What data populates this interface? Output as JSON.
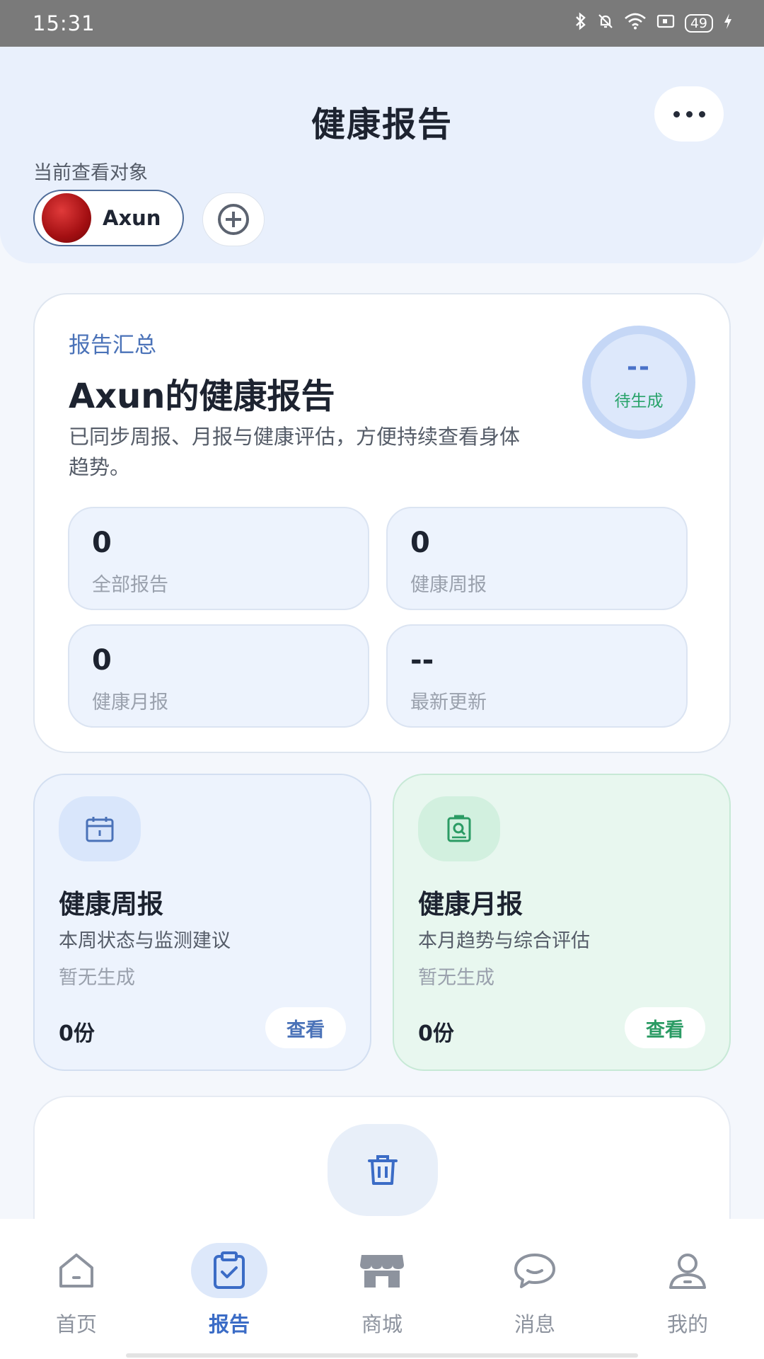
{
  "status_bar": {
    "time": "15:31",
    "battery": "49"
  },
  "header": {
    "title": "健康报告",
    "viewing_label": "当前查看对象",
    "user_name": "Axun"
  },
  "summary": {
    "tag": "报告汇总",
    "title": "Axun的健康报告",
    "description": "已同步周报、月报与健康评估，方便持续查看身体趋势。",
    "score_value": "--",
    "score_status": "待生成",
    "stats": [
      {
        "value": "0",
        "label": "全部报告"
      },
      {
        "value": "0",
        "label": "健康周报"
      },
      {
        "value": "0",
        "label": "健康月报"
      },
      {
        "value": "--",
        "label": "最新更新"
      }
    ]
  },
  "reports": {
    "weekly": {
      "title": "健康周报",
      "subtitle": "本周状态与监测建议",
      "status": "暂无生成",
      "count": "0份",
      "view_label": "查看"
    },
    "monthly": {
      "title": "健康月报",
      "subtitle": "本月趋势与综合评估",
      "status": "暂无生成",
      "count": "0份",
      "view_label": "查看"
    }
  },
  "nav": {
    "items": [
      {
        "label": "首页",
        "icon": "home-icon"
      },
      {
        "label": "报告",
        "icon": "report-icon"
      },
      {
        "label": "商城",
        "icon": "store-icon"
      },
      {
        "label": "消息",
        "icon": "message-icon"
      },
      {
        "label": "我的",
        "icon": "profile-icon"
      }
    ],
    "active_index": 1
  },
  "colors": {
    "accent": "#3b6cc6",
    "green": "#2b9b64",
    "header_bg": "#e9f0fc"
  }
}
